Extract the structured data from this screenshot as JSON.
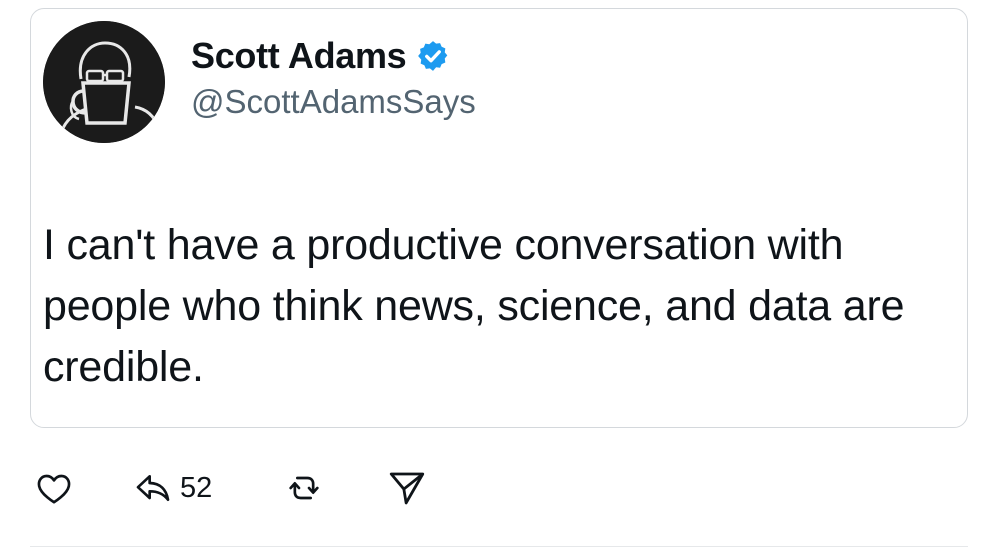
{
  "author": {
    "name": "Scott Adams",
    "handle": "@ScottAdamsSays",
    "verified": true,
    "avatar_icon": "coffee-mug-avatar-icon",
    "verified_icon": "verified-badge-icon"
  },
  "tweet": {
    "text": "I can't have a productive conversation with people who think news, science, and data are credible."
  },
  "actions": {
    "like_icon": "heart-icon",
    "share_icon": "share-arrow-icon",
    "share_count": "52",
    "retweet_icon": "repost-icon",
    "send_icon": "send-icon"
  },
  "colors": {
    "verified": "#1d9bf0",
    "text": "#0f1419",
    "secondary_text": "#536471",
    "border": "#d4d8dc"
  }
}
